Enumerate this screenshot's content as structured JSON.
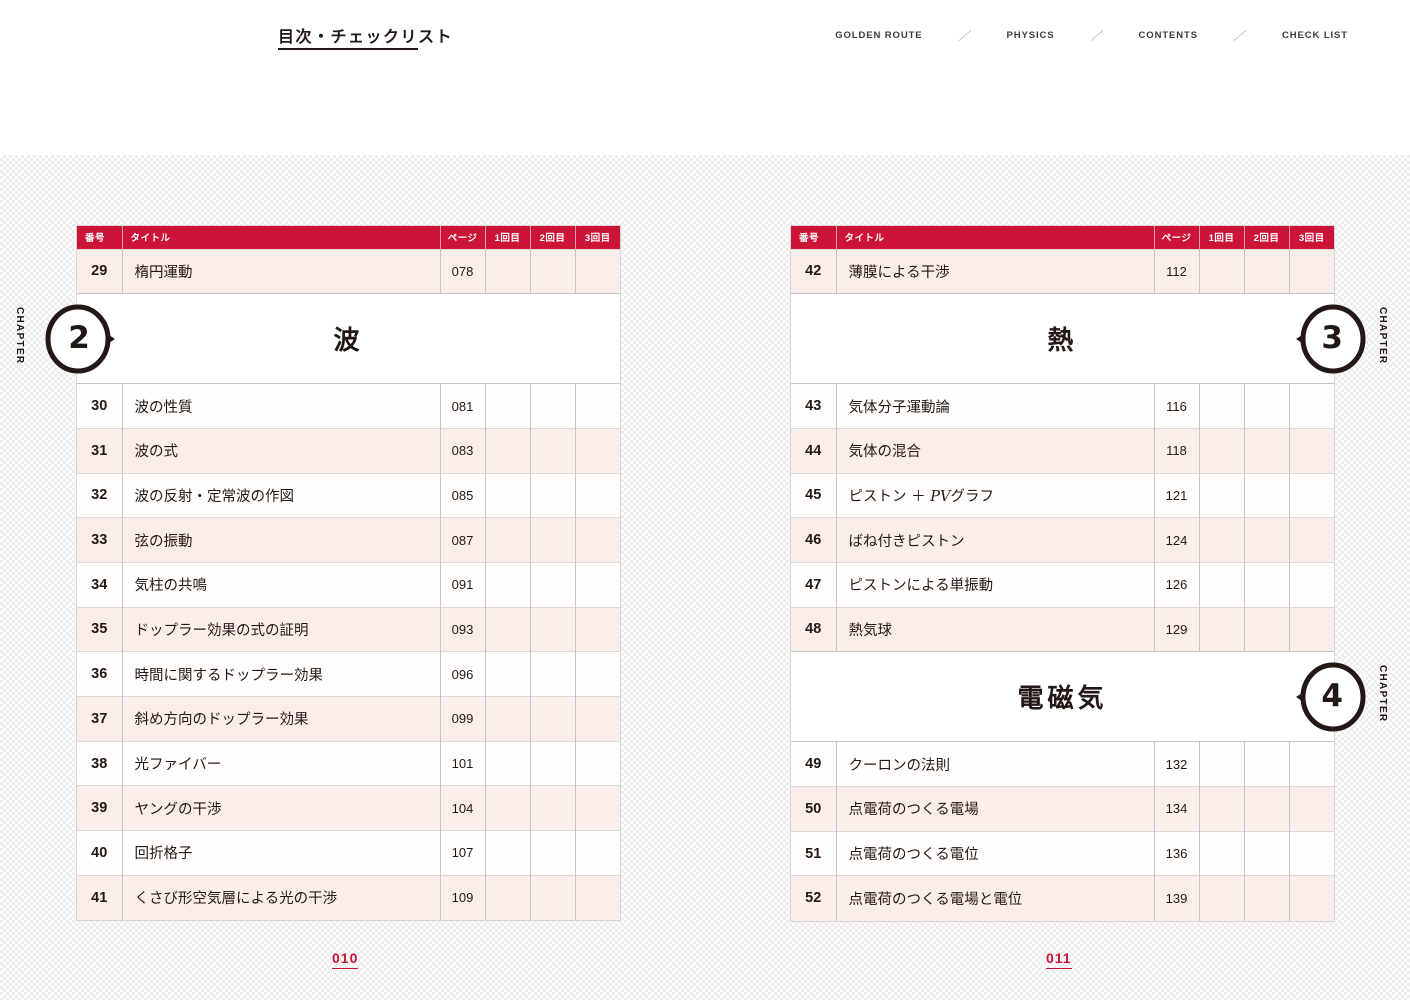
{
  "header": {
    "title": "目次・チェックリスト",
    "nav": [
      {
        "label": "GOLDEN ROUTE"
      },
      {
        "label": "PHYSICS"
      },
      {
        "label": "CONTENTS"
      },
      {
        "label": "CHECK LIST"
      }
    ],
    "nav_separator": "／"
  },
  "columns": {
    "number": "番号",
    "title": "タイトル",
    "page": "ページ",
    "round1": "1回目",
    "round2": "2回目",
    "round3": "3回目"
  },
  "colors": {
    "accent_red": "#cc1338",
    "row_tint": "#faeeea",
    "ink": "#231815",
    "rule": "#c9c4c1"
  },
  "chapter_label": "CHAPTER",
  "left_page": {
    "folio": "010",
    "rows": [
      {
        "type": "item",
        "no": "29",
        "title": "楕円運動",
        "page": "078"
      },
      {
        "type": "chapter",
        "chapter_no": "2",
        "chapter_title": "波"
      },
      {
        "type": "item",
        "no": "30",
        "title": "波の性質",
        "page": "081"
      },
      {
        "type": "item",
        "no": "31",
        "title": "波の式",
        "page": "083"
      },
      {
        "type": "item",
        "no": "32",
        "title": "波の反射・定常波の作図",
        "page": "085"
      },
      {
        "type": "item",
        "no": "33",
        "title": "弦の振動",
        "page": "087"
      },
      {
        "type": "item",
        "no": "34",
        "title": "気柱の共鳴",
        "page": "091"
      },
      {
        "type": "item",
        "no": "35",
        "title": "ドップラー効果の式の証明",
        "page": "093"
      },
      {
        "type": "item",
        "no": "36",
        "title": "時間に関するドップラー効果",
        "page": "096"
      },
      {
        "type": "item",
        "no": "37",
        "title": "斜め方向のドップラー効果",
        "page": "099"
      },
      {
        "type": "item",
        "no": "38",
        "title": "光ファイバー",
        "page": "101"
      },
      {
        "type": "item",
        "no": "39",
        "title": "ヤングの干渉",
        "page": "104"
      },
      {
        "type": "item",
        "no": "40",
        "title": "回折格子",
        "page": "107"
      },
      {
        "type": "item",
        "no": "41",
        "title": "くさび形空気層による光の干渉",
        "page": "109"
      }
    ]
  },
  "right_page": {
    "folio": "011",
    "rows": [
      {
        "type": "item",
        "no": "42",
        "title": "薄膜による干渉",
        "page": "112"
      },
      {
        "type": "chapter",
        "chapter_no": "3",
        "chapter_title": "熱"
      },
      {
        "type": "item",
        "no": "43",
        "title": "気体分子運動論",
        "page": "116"
      },
      {
        "type": "item",
        "no": "44",
        "title": "気体の混合",
        "page": "118"
      },
      {
        "type": "item",
        "no": "45",
        "title": "ピストン ＋ PVグラフ",
        "page": "121",
        "italic_part": "PV"
      },
      {
        "type": "item",
        "no": "46",
        "title": "ばね付きピストン",
        "page": "124"
      },
      {
        "type": "item",
        "no": "47",
        "title": "ピストンによる単振動",
        "page": "126"
      },
      {
        "type": "item",
        "no": "48",
        "title": "熱気球",
        "page": "129"
      },
      {
        "type": "chapter",
        "chapter_no": "4",
        "chapter_title": "電磁気"
      },
      {
        "type": "item",
        "no": "49",
        "title": "クーロンの法則",
        "page": "132"
      },
      {
        "type": "item",
        "no": "50",
        "title": "点電荷のつくる電場",
        "page": "134"
      },
      {
        "type": "item",
        "no": "51",
        "title": "点電荷のつくる電位",
        "page": "136"
      },
      {
        "type": "item",
        "no": "52",
        "title": "点電荷のつくる電場と電位",
        "page": "139"
      }
    ]
  }
}
